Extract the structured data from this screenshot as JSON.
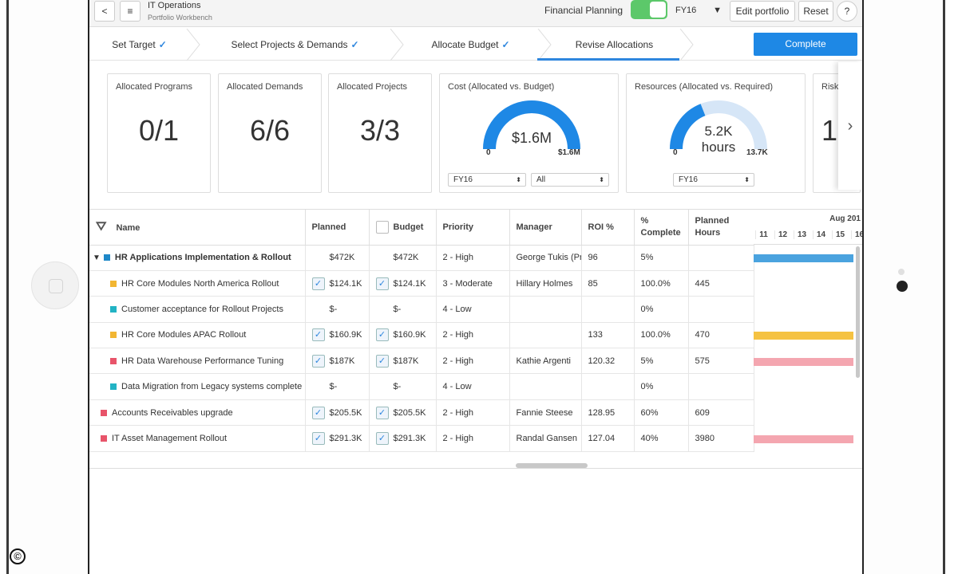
{
  "header": {
    "back_label": "<",
    "menu_label": "≡",
    "title": "IT Operations",
    "subtitle": "Portfolio Workbench",
    "financial_planning_label": "Financial Planning",
    "fy_value": "FY16",
    "edit_label": "Edit portfolio",
    "reset_label": "Reset",
    "help_label": "?"
  },
  "steps": [
    {
      "label": "Set Target",
      "check": "✓"
    },
    {
      "label": "Select Projects & Demands",
      "check": "✓"
    },
    {
      "label": "Allocate Budget",
      "check": "✓"
    },
    {
      "label": "Revise Allocations",
      "check": ""
    }
  ],
  "complete_label": "Complete",
  "kpis": {
    "programs": {
      "title": "Allocated Programs",
      "value": "0/1"
    },
    "demands": {
      "title": "Allocated Demands",
      "value": "6/6"
    },
    "projects": {
      "title": "Allocated Projects",
      "value": "3/3"
    },
    "cost": {
      "title": "Cost (Allocated vs. Budget)",
      "value": "$1.6M",
      "min": "0",
      "max": "$1.6M",
      "sel1": "FY16",
      "sel2": "All",
      "fill": 1.0
    },
    "resources": {
      "title": "Resources (Allocated vs. Required)",
      "value": "5.2K",
      "unit": "hours",
      "min": "0",
      "max": "13.7K",
      "sel1": "FY16",
      "fill": 0.38
    },
    "risks": {
      "title": "Risks",
      "value": "1"
    }
  },
  "grid": {
    "columns": [
      "Name",
      "Planned",
      "Budget",
      "Priority",
      "Manager",
      "ROI %",
      "% Complete",
      "Planned Hours"
    ],
    "gantt_month": "Aug 201",
    "gantt_days": [
      "11",
      "12",
      "13",
      "14",
      "15",
      "16"
    ],
    "rows": [
      {
        "name": "HR Applications Implementation & Rollout",
        "swatch": "#1e88c8",
        "level": 0,
        "group": true,
        "planned": "$472K",
        "budget": "$472K",
        "planned_cb": false,
        "budget_cb": false,
        "show_cb": false,
        "priority": "2 - High",
        "manager": "George Tukis (Pro",
        "roi": "96",
        "complete": "5%",
        "hours": "",
        "bar": "#4aa3df"
      },
      {
        "name": "HR Core Modules North America Rollout",
        "swatch": "#f2b632",
        "level": 1,
        "planned": "$124.1K",
        "budget": "$124.1K",
        "show_cb": true,
        "priority": "3 - Moderate",
        "manager": "Hillary Holmes",
        "roi": "85",
        "complete": "100.0%",
        "hours": "445",
        "bar": ""
      },
      {
        "name": "Customer acceptance for Rollout Projects",
        "swatch": "#22b3c4",
        "level": 1,
        "planned": "$-",
        "budget": "$-",
        "show_cb": false,
        "priority": "4 - Low",
        "manager": "",
        "roi": "",
        "complete": "0%",
        "hours": "",
        "bar": ""
      },
      {
        "name": "HR Core Modules APAC Rollout",
        "swatch": "#f2b632",
        "level": 1,
        "planned": "$160.9K",
        "budget": "$160.9K",
        "show_cb": true,
        "priority": "2 - High",
        "manager": "",
        "roi": "133",
        "complete": "100.0%",
        "hours": "470",
        "bar": "#f5c242"
      },
      {
        "name": "HR Data Warehouse Performance Tuning",
        "swatch": "#e8546a",
        "level": 1,
        "planned": "$187K",
        "budget": "$187K",
        "show_cb": true,
        "priority": "2 - High",
        "manager": "Kathie Argenti",
        "roi": "120.32",
        "complete": "5%",
        "hours": "575",
        "bar": "#f4a6b0"
      },
      {
        "name": "Data Migration from Legacy systems complete",
        "swatch": "#22b3c4",
        "level": 1,
        "planned": "$-",
        "budget": "$-",
        "show_cb": false,
        "priority": "4 - Low",
        "manager": "",
        "roi": "",
        "complete": "0%",
        "hours": "",
        "bar": ""
      },
      {
        "name": "Accounts Receivables upgrade",
        "swatch": "#e8546a",
        "level": 0,
        "planned": "$205.5K",
        "budget": "$205.5K",
        "show_cb": true,
        "priority": "2 - High",
        "manager": "Fannie Steese",
        "roi": "128.95",
        "complete": "60%",
        "hours": "609",
        "bar": ""
      },
      {
        "name": "IT Asset Management Rollout",
        "swatch": "#e8546a",
        "level": 0,
        "planned": "$291.3K",
        "budget": "$291.3K",
        "show_cb": true,
        "priority": "2 - High",
        "manager": "Randal Gansen",
        "roi": "127.04",
        "complete": "40%",
        "hours": "3980",
        "bar": "#f4a6b0"
      }
    ]
  },
  "copyright": "©"
}
